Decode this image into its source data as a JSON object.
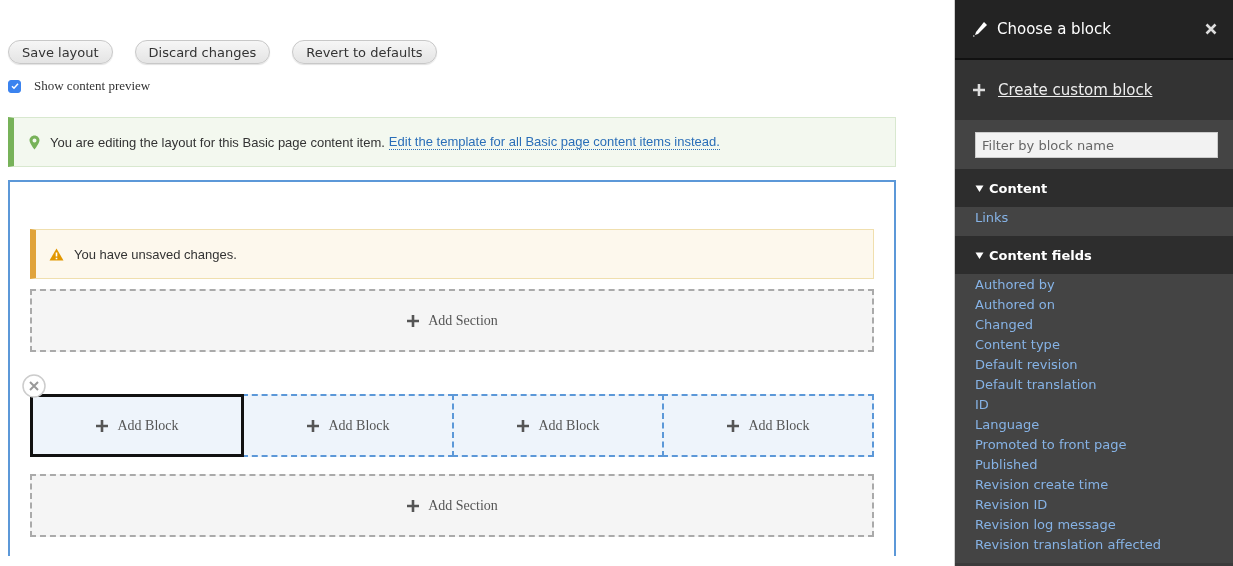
{
  "toolbar": {
    "buttons": [
      "Save layout",
      "Discard changes",
      "Revert to defaults"
    ]
  },
  "preview": {
    "label": "Show content preview",
    "checked": true
  },
  "message": {
    "text": "You are editing the layout for this Basic page content item.",
    "link": "Edit the template for all Basic page content items instead."
  },
  "layout": {
    "warning": "You have unsaved changes.",
    "rows": [
      {
        "kind": "add_section",
        "label": "Add Section"
      },
      {
        "kind": "section",
        "regions": [
          {
            "label": "Add Block",
            "selected": true
          },
          {
            "label": "Add Block",
            "selected": false
          },
          {
            "label": "Add Block",
            "selected": false
          },
          {
            "label": "Add Block",
            "selected": false
          }
        ]
      },
      {
        "kind": "add_section",
        "label": "Add Section"
      }
    ]
  },
  "panel": {
    "title": "Choose a block",
    "create_link": "Create custom block",
    "filter": {
      "placeholder": "Filter by block name"
    },
    "groups": [
      {
        "title": "Content",
        "expanded": true,
        "items": [
          "Links"
        ]
      },
      {
        "title": "Content fields",
        "expanded": true,
        "items": [
          "Authored by",
          "Authored on",
          "Changed",
          "Content type",
          "Default revision",
          "Default translation",
          "ID",
          "Language",
          "Promoted to front page",
          "Published",
          "Revision create time",
          "Revision ID",
          "Revision log message",
          "Revision translation affected"
        ]
      }
    ]
  }
}
